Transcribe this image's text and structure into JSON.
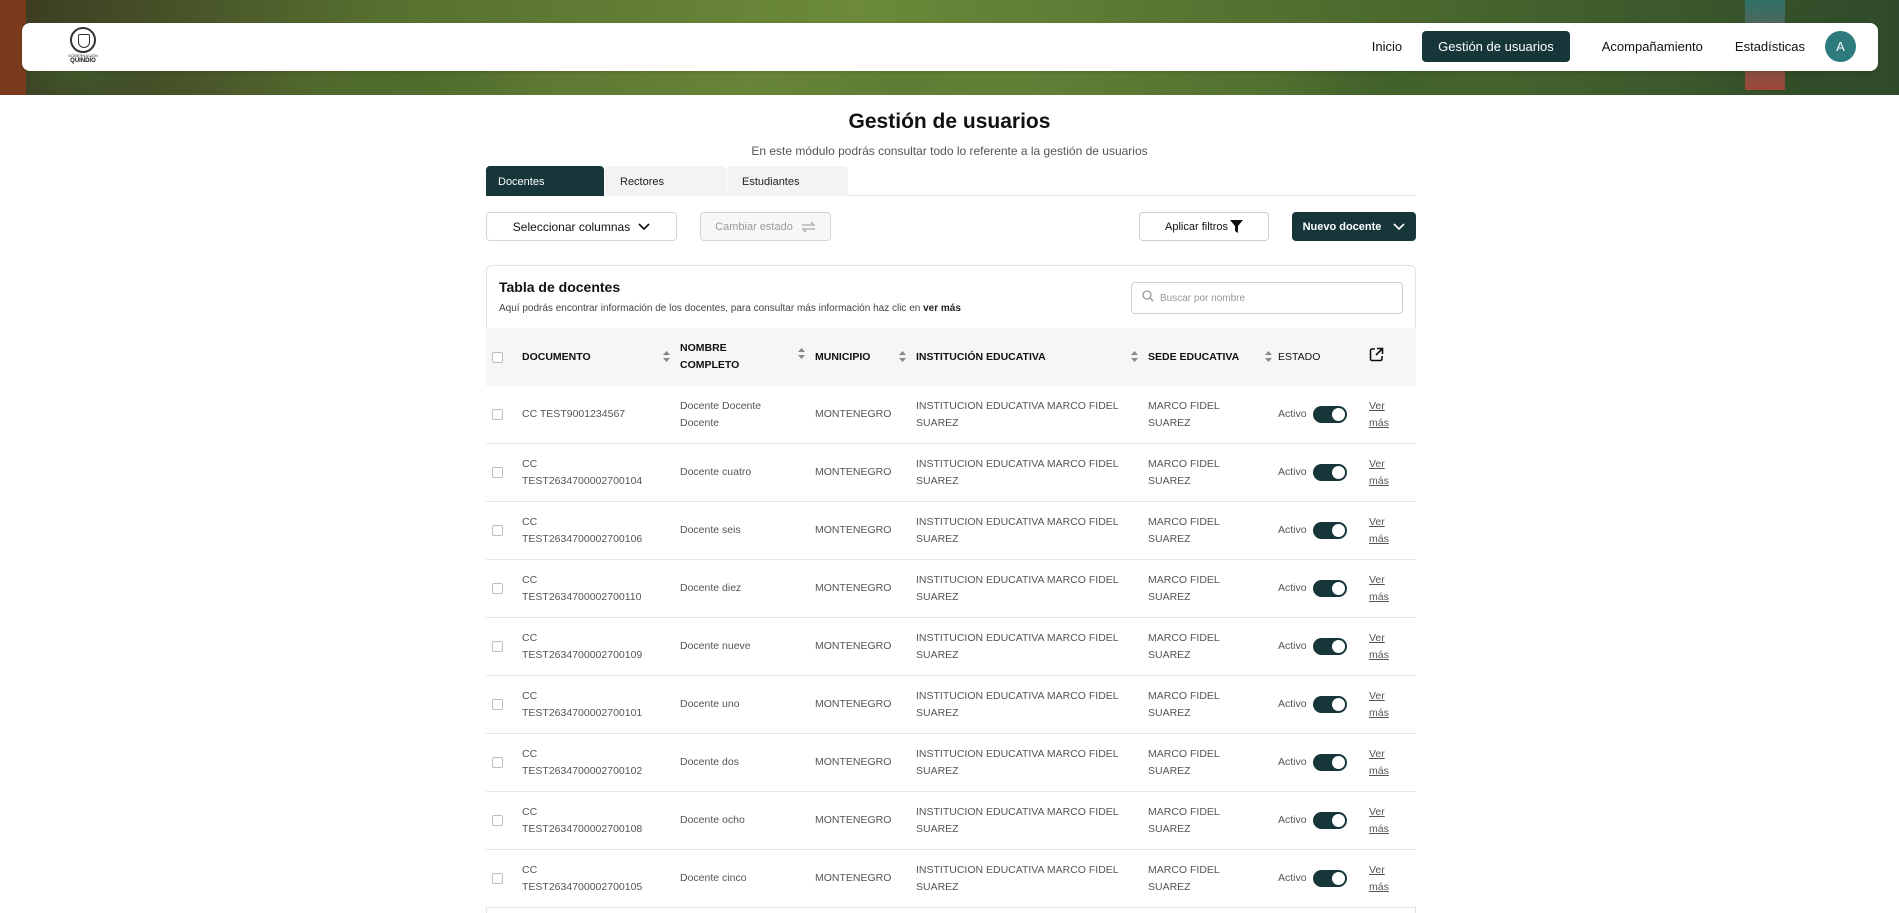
{
  "nav": {
    "logo_small": "GOBERNACIÓN",
    "logo_big": "QUINDÍO",
    "links": [
      "Inicio",
      "Gestión de usuarios",
      "Acompañamiento",
      "Estadísticas"
    ],
    "avatar_initial": "A"
  },
  "page": {
    "title": "Gestión de usuarios",
    "subtitle": "En este módulo podrás consultar todo lo referente a la gestión de usuarios"
  },
  "tabs": [
    "Docentes",
    "Rectores",
    "Estudiantes"
  ],
  "toolbar": {
    "columns_label": "Seleccionar columnas",
    "state_label": "Cambiar estado",
    "filters_label": "Aplicar filtros",
    "new_label": "Nuevo docente"
  },
  "table": {
    "title": "Tabla de docentes",
    "description_prefix": "Aquí podrás encontrar información de los docentes, para consultar más información haz clic en",
    "description_link": "ver más",
    "search_placeholder": "Buscar por nombre",
    "headers": {
      "documento": "DOCUMENTO",
      "nombre_1": "NOMBRE",
      "nombre_2": "COMPLETO",
      "municipio": "MUNICIPIO",
      "institucion": "INSTITUCIÓN EDUCATIVA",
      "sede": "SEDE EDUCATIVA",
      "estado": "ESTADO"
    },
    "rows": [
      {
        "doc1": "CC TEST9001234567",
        "doc2": "",
        "name1": "Docente Docente",
        "name2": "Docente",
        "municipio": "MONTENEGRO",
        "inst1": "INSTITUCION EDUCATIVA MARCO FIDEL",
        "inst2": "SUAREZ",
        "sede1": "MARCO FIDEL",
        "sede2": "SUAREZ",
        "estado": "Activo",
        "ver1": "Ver",
        "ver2": "más"
      },
      {
        "doc1": "CC",
        "doc2": "TEST2634700002700104",
        "name1": "Docente cuatro",
        "name2": "",
        "municipio": "MONTENEGRO",
        "inst1": "INSTITUCION EDUCATIVA MARCO FIDEL",
        "inst2": "SUAREZ",
        "sede1": "MARCO FIDEL",
        "sede2": "SUAREZ",
        "estado": "Activo",
        "ver1": "Ver",
        "ver2": "más"
      },
      {
        "doc1": "CC",
        "doc2": "TEST2634700002700106",
        "name1": "Docente seis",
        "name2": "",
        "municipio": "MONTENEGRO",
        "inst1": "INSTITUCION EDUCATIVA MARCO FIDEL",
        "inst2": "SUAREZ",
        "sede1": "MARCO FIDEL",
        "sede2": "SUAREZ",
        "estado": "Activo",
        "ver1": "Ver",
        "ver2": "más"
      },
      {
        "doc1": "CC",
        "doc2": "TEST2634700002700110",
        "name1": "Docente diez",
        "name2": "",
        "municipio": "MONTENEGRO",
        "inst1": "INSTITUCION EDUCATIVA MARCO FIDEL",
        "inst2": "SUAREZ",
        "sede1": "MARCO FIDEL",
        "sede2": "SUAREZ",
        "estado": "Activo",
        "ver1": "Ver",
        "ver2": "más"
      },
      {
        "doc1": "CC",
        "doc2": "TEST2634700002700109",
        "name1": "Docente nueve",
        "name2": "",
        "municipio": "MONTENEGRO",
        "inst1": "INSTITUCION EDUCATIVA MARCO FIDEL",
        "inst2": "SUAREZ",
        "sede1": "MARCO FIDEL",
        "sede2": "SUAREZ",
        "estado": "Activo",
        "ver1": "Ver",
        "ver2": "más"
      },
      {
        "doc1": "CC",
        "doc2": "TEST2634700002700101",
        "name1": "Docente uno",
        "name2": "",
        "municipio": "MONTENEGRO",
        "inst1": "INSTITUCION EDUCATIVA MARCO FIDEL",
        "inst2": "SUAREZ",
        "sede1": "MARCO FIDEL",
        "sede2": "SUAREZ",
        "estado": "Activo",
        "ver1": "Ver",
        "ver2": "más"
      },
      {
        "doc1": "CC",
        "doc2": "TEST2634700002700102",
        "name1": "Docente dos",
        "name2": "",
        "municipio": "MONTENEGRO",
        "inst1": "INSTITUCION EDUCATIVA MARCO FIDEL",
        "inst2": "SUAREZ",
        "sede1": "MARCO FIDEL",
        "sede2": "SUAREZ",
        "estado": "Activo",
        "ver1": "Ver",
        "ver2": "más"
      },
      {
        "doc1": "CC",
        "doc2": "TEST2634700002700108",
        "name1": "Docente ocho",
        "name2": "",
        "municipio": "MONTENEGRO",
        "inst1": "INSTITUCION EDUCATIVA MARCO FIDEL",
        "inst2": "SUAREZ",
        "sede1": "MARCO FIDEL",
        "sede2": "SUAREZ",
        "estado": "Activo",
        "ver1": "Ver",
        "ver2": "más"
      },
      {
        "doc1": "CC",
        "doc2": "TEST2634700002700105",
        "name1": "Docente cinco",
        "name2": "",
        "municipio": "MONTENEGRO",
        "inst1": "INSTITUCION EDUCATIVA MARCO FIDEL",
        "inst2": "SUAREZ",
        "sede1": "MARCO FIDEL",
        "sede2": "SUAREZ",
        "estado": "Activo",
        "ver1": "Ver",
        "ver2": "más"
      }
    ]
  },
  "colors": {
    "primary": "#16363a",
    "avatar": "#2e7b7d"
  },
  "icons": [
    "chevron-down-icon",
    "swap-icon",
    "filter-icon",
    "search-icon",
    "sort-icon",
    "external-link-icon"
  ]
}
